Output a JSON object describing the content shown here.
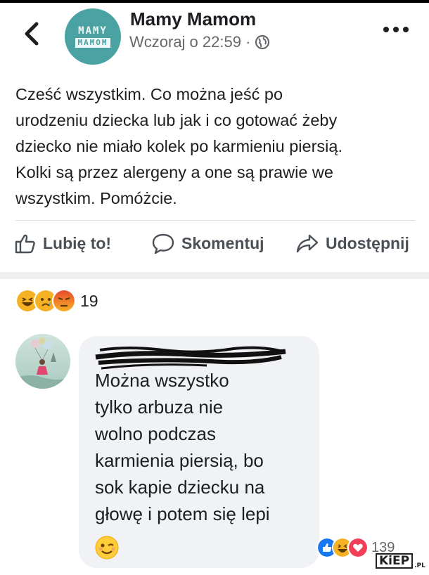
{
  "header": {
    "back_icon": "chevron-left-icon",
    "page_avatar_line1": "MAMY",
    "page_avatar_line2": "MAMOM",
    "page_name": "Mamy Mamom",
    "timestamp": "Wczoraj o 22:59 ·",
    "audience_icon": "globe-icon",
    "more_icon": "more-horizontal-icon"
  },
  "post": {
    "text": "Cześć wszystkim. Co można jeść po\nurodzeniu dziecka lub jak i co gotować żeby\ndziecko nie miało kolek po karmieniu piersią.\nKolki są przez alergeny a one są prawie we\nwszystkim. Pomóżcie."
  },
  "actions": {
    "like_label": "Lubię to!",
    "comment_label": "Skomentuj",
    "share_label": "Udostępnij"
  },
  "reactions_summary": {
    "icons": [
      "haha-icon",
      "sad-icon",
      "angry-icon"
    ],
    "count": "19"
  },
  "comment": {
    "text": "Można wszystko\ntylko arbuza nie\nwolno podczas\nkarmienia piersią, bo\nsok kapie dziecku na\ngłowę i potem się lepi",
    "emoji_icon": "wink-icon",
    "reactions": {
      "icons": [
        "like-icon",
        "haha-icon",
        "love-icon"
      ],
      "count": "139"
    }
  },
  "watermark": {
    "brand": "KiEP",
    "suffix": ".PL"
  },
  "colors": {
    "page_avatar_bg": "#4aa3a2",
    "text_primary": "#1c1e21",
    "text_secondary": "#65676b",
    "action_text": "#4b4f56",
    "bubble_bg": "#f0f2f5",
    "like_blue": "#1877f2",
    "love_red": "#f33e58",
    "reaction_yellow": "#f7b125"
  }
}
